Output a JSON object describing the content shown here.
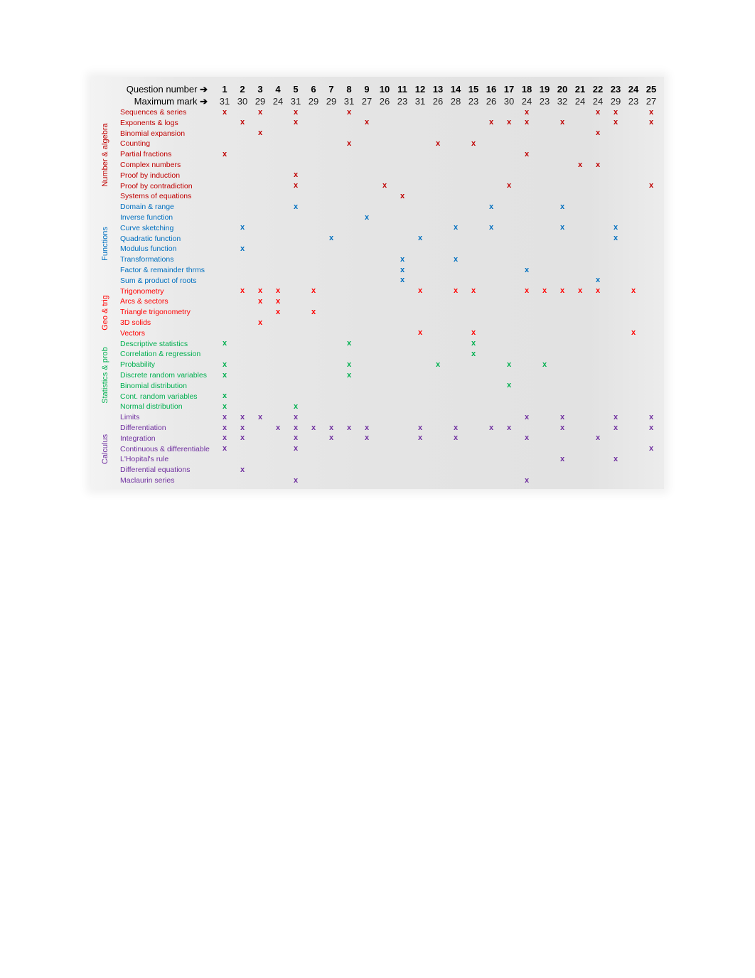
{
  "header": {
    "question_label": "Question number",
    "max_label": "Maximum mark",
    "arrow": "➔"
  },
  "questions": [
    1,
    2,
    3,
    4,
    5,
    6,
    7,
    8,
    9,
    10,
    11,
    12,
    13,
    14,
    15,
    16,
    17,
    18,
    19,
    20,
    21,
    22,
    23,
    24,
    25
  ],
  "max_marks": [
    31,
    30,
    29,
    24,
    31,
    29,
    29,
    31,
    27,
    26,
    23,
    31,
    26,
    28,
    23,
    26,
    30,
    24,
    23,
    32,
    24,
    24,
    29,
    23,
    27
  ],
  "mark_symbol": "x",
  "categories": [
    {
      "name": "Number & algebra",
      "color": "#c00000",
      "topics": [
        {
          "name": "Sequences & series",
          "questions": [
            1,
            3,
            5,
            8,
            18,
            22,
            23,
            25
          ]
        },
        {
          "name": "Exponents & logs",
          "questions": [
            2,
            5,
            9,
            16,
            17,
            18,
            20,
            23,
            25
          ]
        },
        {
          "name": "Binomial expansion",
          "questions": [
            3,
            22
          ]
        },
        {
          "name": "Counting",
          "questions": [
            8,
            13,
            15
          ]
        },
        {
          "name": "Partial fractions",
          "questions": [
            1,
            18
          ]
        },
        {
          "name": "Complex numbers",
          "questions": [
            21,
            22
          ]
        },
        {
          "name": "Proof by induction",
          "questions": [
            5
          ]
        },
        {
          "name": "Proof by contradiction",
          "questions": [
            5,
            10,
            17,
            25
          ]
        },
        {
          "name": "Systems of equations",
          "questions": [
            11
          ]
        }
      ]
    },
    {
      "name": "Functions",
      "color": "#0070c0",
      "topics": [
        {
          "name": "Domain & range",
          "questions": [
            5,
            16,
            20
          ]
        },
        {
          "name": "Inverse function",
          "questions": [
            9
          ]
        },
        {
          "name": "Curve sketching",
          "questions": [
            2,
            14,
            16,
            20,
            23
          ]
        },
        {
          "name": "Quadratic function",
          "questions": [
            7,
            12,
            23
          ]
        },
        {
          "name": "Modulus function",
          "questions": [
            2
          ]
        },
        {
          "name": "Transformations",
          "questions": [
            11,
            14
          ]
        },
        {
          "name": "Factor & remainder thrms",
          "questions": [
            11,
            18
          ]
        },
        {
          "name": "Sum & product of roots",
          "questions": [
            11,
            22
          ]
        }
      ]
    },
    {
      "name": "Geo & trig",
      "color": "#ff0000",
      "topics": [
        {
          "name": "Trigonometry",
          "questions": [
            2,
            3,
            4,
            6,
            12,
            14,
            15,
            18,
            19,
            20,
            21,
            22,
            24
          ]
        },
        {
          "name": "Arcs & sectors",
          "questions": [
            3,
            4
          ]
        },
        {
          "name": "Triangle trigonometry",
          "questions": [
            4,
            6
          ]
        },
        {
          "name": "3D solids",
          "questions": [
            3
          ]
        },
        {
          "name": "Vectors",
          "questions": [
            12,
            15,
            24
          ]
        }
      ]
    },
    {
      "name": "Statistics & prob",
      "color": "#00b050",
      "topics": [
        {
          "name": "Descriptive statistics",
          "questions": [
            1,
            8,
            15
          ]
        },
        {
          "name": "Correlation & regression",
          "questions": [
            15
          ]
        },
        {
          "name": "Probability",
          "questions": [
            1,
            8,
            13,
            17,
            19
          ]
        },
        {
          "name": "Discrete random variables",
          "questions": [
            1,
            8
          ]
        },
        {
          "name": "Binomial distribution",
          "questions": [
            17
          ]
        },
        {
          "name": "Cont. random variables",
          "questions": [
            1
          ]
        },
        {
          "name": "Normal distribution",
          "questions": [
            1,
            5
          ]
        }
      ]
    },
    {
      "name": "Calculus",
      "color": "#7030a0",
      "topics": [
        {
          "name": "Limits",
          "questions": [
            1,
            2,
            3,
            5,
            18,
            20,
            23,
            25
          ]
        },
        {
          "name": "Differentiation",
          "questions": [
            1,
            2,
            4,
            5,
            6,
            7,
            8,
            9,
            12,
            14,
            16,
            17,
            20,
            23,
            25
          ]
        },
        {
          "name": "Integration",
          "questions": [
            1,
            2,
            5,
            7,
            9,
            12,
            14,
            18,
            22
          ]
        },
        {
          "name": "Continuous & differentiable",
          "questions": [
            1,
            5,
            25
          ]
        },
        {
          "name": "L'Hopital's rule",
          "questions": [
            20,
            23
          ]
        },
        {
          "name": "Differential equations",
          "questions": [
            2
          ]
        },
        {
          "name": "Maclaurin series",
          "questions": [
            5,
            18
          ]
        }
      ]
    }
  ]
}
